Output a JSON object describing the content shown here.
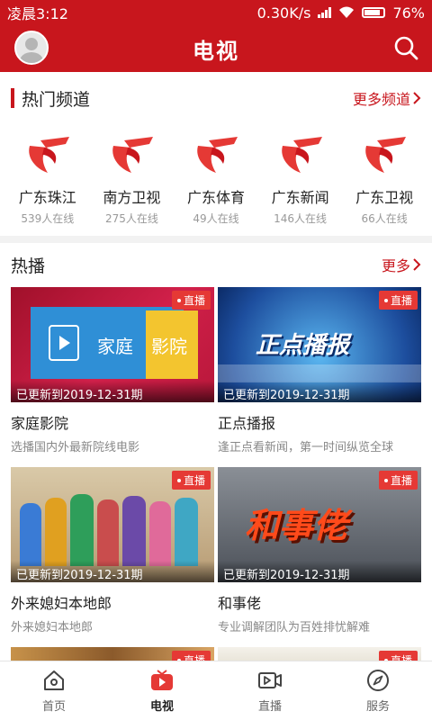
{
  "status": {
    "time": "凌晨3:12",
    "speed": "0.30K/s",
    "battery": "76%"
  },
  "header": {
    "title": "电视"
  },
  "channels_section": {
    "title": "热门频道",
    "more": "更多频道"
  },
  "channels": [
    {
      "name": "广东珠江",
      "viewers": "539人在线"
    },
    {
      "name": "南方卫视",
      "viewers": "275人在线"
    },
    {
      "name": "广东体育",
      "viewers": "49人在线"
    },
    {
      "name": "广东新闻",
      "viewers": "146人在线"
    },
    {
      "name": "广东卫视",
      "viewers": "66人在线"
    }
  ],
  "hot_section": {
    "title": "热播",
    "more": "更多"
  },
  "programs": [
    {
      "title": "家庭影院",
      "desc": "选播国内外最新院线电影",
      "badge": "直播",
      "updated": "已更新到2019-12-31期",
      "thumb_text": [
        "家庭",
        "影院"
      ]
    },
    {
      "title": "正点播报",
      "desc": "逢正点看新闻，第一时间纵览全球",
      "badge": "直播",
      "updated": "已更新到2019-12-31期",
      "thumb_text": "正点播报"
    },
    {
      "title": "外来媳妇本地郎",
      "desc": "外来媳妇本地郎",
      "badge": "直播",
      "updated": "已更新到2019-12-31期",
      "thumb_text": ""
    },
    {
      "title": "和事佬",
      "desc": "专业调解团队为百姓排忧解难",
      "badge": "直播",
      "updated": "已更新到2019-12-31期",
      "thumb_text": "和事佬"
    },
    {
      "badge": "直播"
    },
    {
      "badge": "直播"
    }
  ],
  "tabs": [
    {
      "label": "首页",
      "icon": "home-icon"
    },
    {
      "label": "电视",
      "icon": "tv-icon"
    },
    {
      "label": "直播",
      "icon": "live-video-icon"
    },
    {
      "label": "服务",
      "icon": "compass-icon"
    }
  ],
  "colors": {
    "brand": "#c8161d",
    "badge": "#e53935"
  }
}
